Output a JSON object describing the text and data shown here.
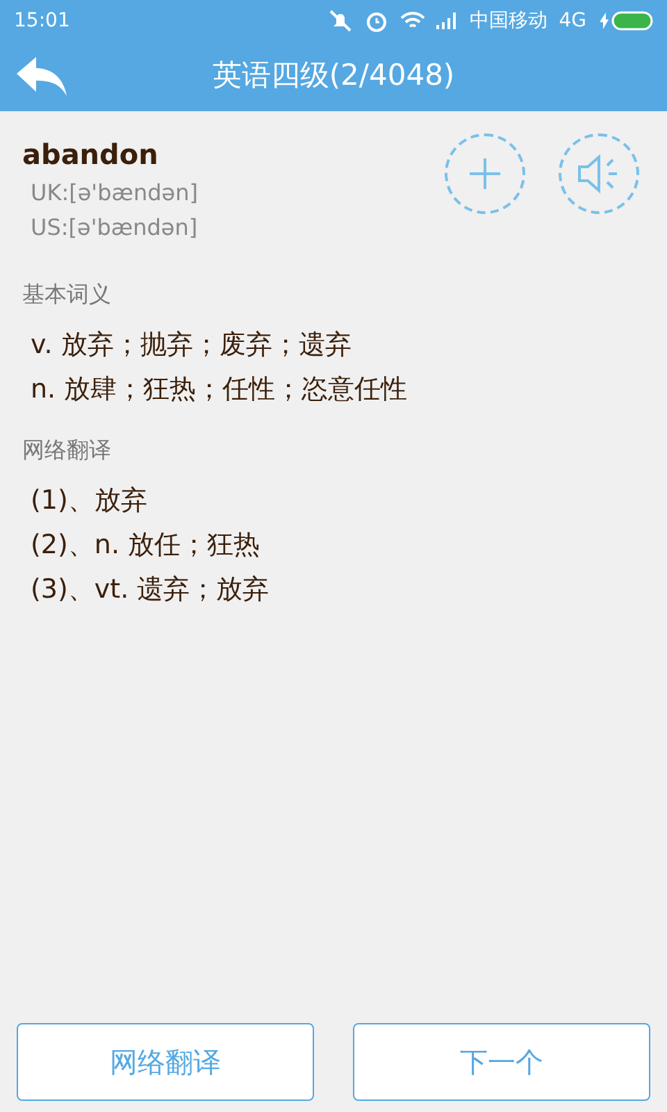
{
  "status_bar": {
    "time": "15:01",
    "carrier": "中国移动",
    "network": "4G"
  },
  "toolbar": {
    "title": "英语四级(2/4048)"
  },
  "word": {
    "text": "abandon",
    "phonetics": [
      "UK:[ə'bændən]",
      "US:[ə'bændən]"
    ]
  },
  "sections": [
    {
      "heading": "基本词义",
      "lines": [
        "v. 放弃；抛弃；废弃；遗弃",
        "n. 放肆；狂热；任性；恣意任性"
      ]
    },
    {
      "heading": "网络翻译",
      "lines": [
        "(1)、放弃",
        "(2)、n. 放任；狂热",
        "(3)、vt. 遗弃；放弃"
      ]
    }
  ],
  "buttons": [
    "网络翻译",
    "下一个"
  ]
}
